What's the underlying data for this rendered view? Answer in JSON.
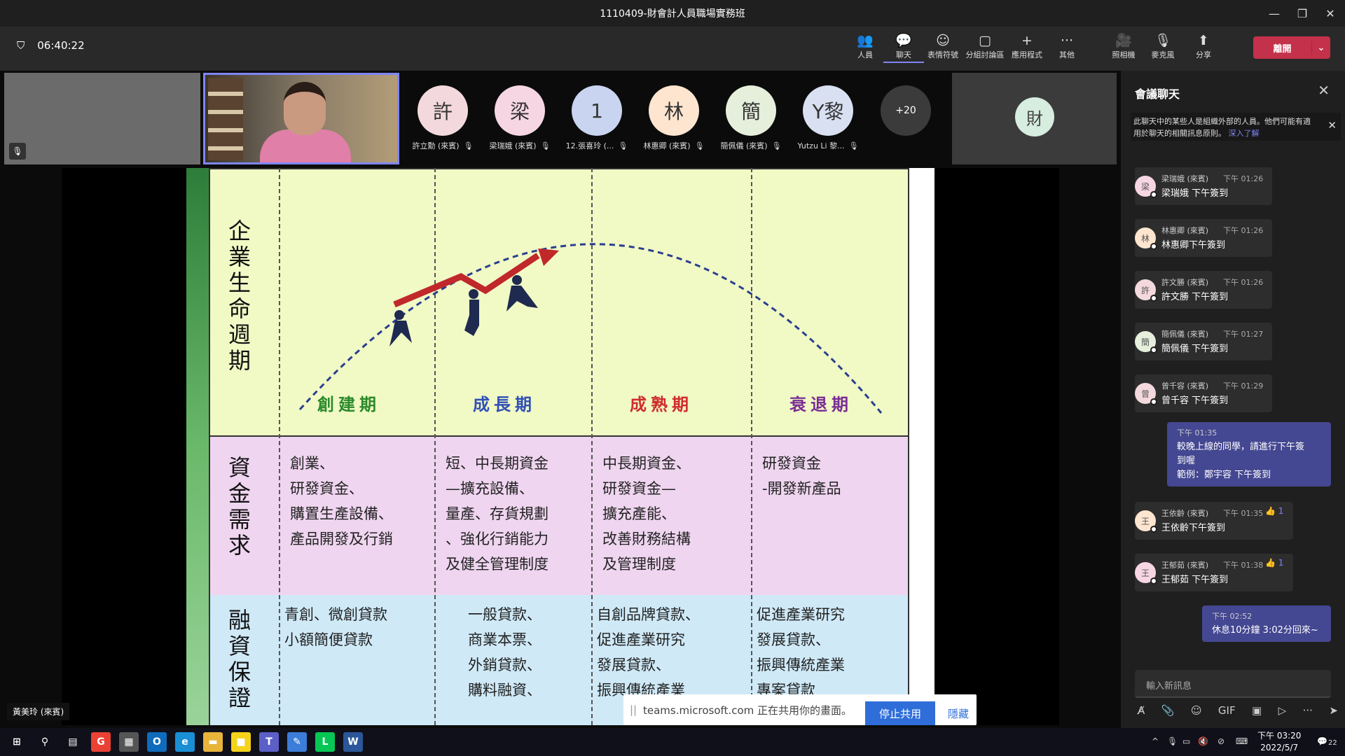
{
  "window": {
    "title": "1110409-財會計人員職場實務班",
    "minimize": "—",
    "restore": "❐",
    "close": "✕"
  },
  "meeting": {
    "timer": "06:40:22"
  },
  "toolbar": {
    "items": [
      {
        "label": "人員",
        "icon": "👥"
      },
      {
        "label": "聊天",
        "icon": "💬"
      },
      {
        "label": "表情符號",
        "icon": "☺"
      },
      {
        "label": "分組討論區",
        "icon": "▢"
      },
      {
        "label": "應用程式",
        "icon": "+"
      },
      {
        "label": "其他",
        "icon": "···"
      },
      {
        "label": "照相機",
        "icon": "🎥"
      },
      {
        "label": "麥克風",
        "icon": "🎙"
      },
      {
        "label": "分享",
        "icon": "⬆"
      }
    ],
    "leave_label": "離開",
    "leave_arrow": "⌄"
  },
  "participants": [
    {
      "initial": "許",
      "name": "許立勳 (來賓)",
      "color": "#f3d9dd"
    },
    {
      "initial": "梁",
      "name": "梁瑞娥 (來賓)",
      "color": "#f7d6e3"
    },
    {
      "initial": "1",
      "name": "12.張喜玲 (...",
      "color": "#c9d4f0"
    },
    {
      "initial": "林",
      "name": "林惠卿 (來賓)",
      "color": "#fde5cf"
    },
    {
      "initial": "簡",
      "name": "簡佩儀 (來賓)",
      "color": "#e6efdc"
    },
    {
      "initial": "Y黎",
      "name": "Yutzu Li 黎...",
      "color": "#d8e0f2"
    }
  ],
  "overflow_count": "+20",
  "big_tile_initial": "財",
  "presenter_name": "黃美玲 (來賓)",
  "slide": {
    "row_labels": [
      "企業生命週期",
      "資金需求",
      "融資保證"
    ],
    "phases": [
      {
        "label": "創建期",
        "color": "#2a8a2a"
      },
      {
        "label": "成長期",
        "color": "#2f4fb8"
      },
      {
        "label": "成熟期",
        "color": "#d02d2d"
      },
      {
        "label": "衰退期",
        "color": "#7a2d95"
      }
    ],
    "funding": [
      [
        "創業、",
        "研發資金、",
        "購置生產設備、",
        "產品開發及行銷"
      ],
      [
        "短、中長期資金",
        "—擴充設備、",
        "量產、存貨規劃",
        "、強化行銷能力",
        "及健全管理制度"
      ],
      [
        "中長期資金、",
        "研發資金—",
        "擴充產能、",
        "改善財務結構",
        "及管理制度"
      ],
      [
        "研發資金",
        "-開發新產品"
      ]
    ],
    "guarantee": [
      [
        "青創、微創貸款",
        "小額簡便貸款"
      ],
      [
        "一般貸款、",
        "商業本票、",
        "外銷貸款、",
        "購料融資、"
      ],
      [
        "自創品牌貸款、",
        "促進產業研究",
        "發展貸款、",
        "振興傳統產業"
      ],
      [
        "促進產業研究",
        "發展貸款、",
        "振興傳統產業",
        "專案貸款"
      ]
    ]
  },
  "sharebar": {
    "grip": "||",
    "text": "teams.microsoft.com 正在共用你的畫面。",
    "stop": "停止共用",
    "hide": "隱藏"
  },
  "chat": {
    "title": "會議聊天",
    "notice": "此聊天中的某些人是組織外部的人員。他們可能有適用於聊天的相關訊息原則。",
    "notice_link": "深入了解",
    "messages": [
      {
        "initial": "梁",
        "name": "梁瑞娥 (來賓)",
        "time": "下午 01:26",
        "text": "梁瑞娥 下午簽到",
        "color": "#f7d6e3",
        "reaction": ""
      },
      {
        "initial": "林",
        "name": "林惠卿 (來賓)",
        "time": "下午 01:26",
        "text": "林惠卿下午簽到",
        "color": "#fde5cf",
        "reaction": ""
      },
      {
        "initial": "許",
        "name": "許文勝 (來賓)",
        "time": "下午 01:26",
        "text": "許文勝 下午簽到",
        "color": "#f3d9dd",
        "reaction": ""
      },
      {
        "initial": "簡",
        "name": "簡佩儀 (來賓)",
        "time": "下午 01:27",
        "text": "簡佩儀 下午簽到",
        "color": "#e6efdc",
        "reaction": ""
      },
      {
        "initial": "曾",
        "name": "曾千容 (來賓)",
        "time": "下午 01:29",
        "text": "曾千容 下午簽到",
        "color": "#f3d9dd",
        "reaction": ""
      },
      {
        "initial": "王",
        "name": "王依齡 (來賓)",
        "time": "下午 01:35",
        "text": "王依齡下午簽到",
        "color": "#fde5cf",
        "reaction": "👍 1"
      },
      {
        "initial": "王",
        "name": "王郁茹 (來賓)",
        "time": "下午 01:38",
        "text": "王郁茹 下午簽到",
        "color": "#f7d6e3",
        "reaction": "👍 1"
      }
    ],
    "my_messages": [
      {
        "time": "下午 01:35",
        "lines": [
          "較晚上線的同學，請進行下午簽",
          "到喔",
          "範例：鄭宇容 下午簽到"
        ]
      },
      {
        "time": "下午 02:52",
        "lines": [
          "休息10分鐘 3:02分回來~"
        ]
      }
    ],
    "input_placeholder": "輸入新訊息",
    "tools": [
      "A̸",
      "📎",
      "☺",
      "GIF",
      "▣",
      "▷",
      "···",
      "➤"
    ]
  },
  "taskbar": {
    "apps": [
      {
        "icon": "⊞",
        "color": "#10101a"
      },
      {
        "icon": "⚲",
        "color": "#10101a"
      },
      {
        "icon": "▤",
        "color": "#10101a"
      },
      {
        "icon": "G",
        "color": "#e94235"
      },
      {
        "icon": "▦",
        "color": "#555555"
      },
      {
        "icon": "O",
        "color": "#0f6cbd"
      },
      {
        "icon": "e",
        "color": "#1a8fd6"
      },
      {
        "icon": "▬",
        "color": "#e8b43a"
      },
      {
        "icon": "■",
        "color": "#f5d31a"
      },
      {
        "icon": "T",
        "color": "#5b5fc7"
      },
      {
        "icon": "✎",
        "color": "#3b7dd8"
      },
      {
        "icon": "L",
        "color": "#06c755"
      },
      {
        "icon": "W",
        "color": "#2b579a"
      }
    ],
    "time": "下午 03:20",
    "date": "2022/5/7",
    "notif_count": "22"
  }
}
